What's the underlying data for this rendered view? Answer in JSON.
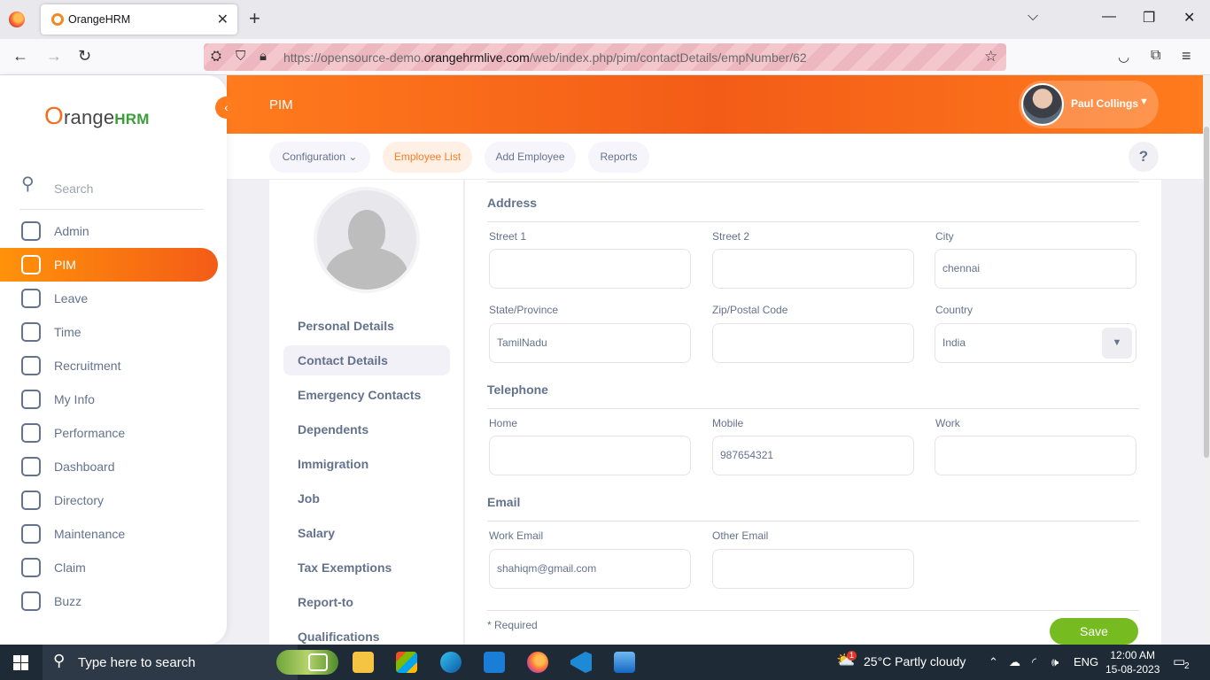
{
  "browser": {
    "tab_title": "OrangeHRM",
    "url_prefix": "https://opensource-demo.",
    "url_domain": "orangehrmlive.com",
    "url_path": "/web/index.php/pim/contactDetails/empNumber/62"
  },
  "sidebar": {
    "brand_o": "O",
    "brand_range": "range",
    "brand_hrm": "HRM",
    "search_placeholder": "Search",
    "items": [
      {
        "label": "Admin"
      },
      {
        "label": "PIM"
      },
      {
        "label": "Leave"
      },
      {
        "label": "Time"
      },
      {
        "label": "Recruitment"
      },
      {
        "label": "My Info"
      },
      {
        "label": "Performance"
      },
      {
        "label": "Dashboard"
      },
      {
        "label": "Directory"
      },
      {
        "label": "Maintenance"
      },
      {
        "label": "Claim"
      },
      {
        "label": "Buzz"
      }
    ]
  },
  "header": {
    "module": "PIM",
    "user_name": "Paul Collings"
  },
  "subnav": {
    "configuration": "Configuration",
    "employee_list": "Employee List",
    "add_employee": "Add Employee",
    "reports": "Reports",
    "help": "?"
  },
  "employee_tabs": [
    "Personal Details",
    "Contact Details",
    "Emergency Contacts",
    "Dependents",
    "Immigration",
    "Job",
    "Salary",
    "Tax Exemptions",
    "Report-to",
    "Qualifications"
  ],
  "form": {
    "address_title": "Address",
    "street1_label": "Street 1",
    "street1_value": "",
    "street2_label": "Street 2",
    "street2_value": "",
    "city_label": "City",
    "city_value": "chennai",
    "state_label": "State/Province",
    "state_value": "TamilNadu",
    "zip_label": "Zip/Postal Code",
    "zip_value": "",
    "country_label": "Country",
    "country_value": "India",
    "telephone_title": "Telephone",
    "home_label": "Home",
    "home_value": "",
    "mobile_label": "Mobile",
    "mobile_value": "987654321",
    "work_label": "Work",
    "work_value": "",
    "email_title": "Email",
    "work_email_label": "Work Email",
    "work_email_value": "shahiqm@gmail.com",
    "other_email_label": "Other Email",
    "other_email_value": "",
    "required_note": "* Required",
    "save_label": "Save"
  },
  "taskbar": {
    "search_text": "Type here to search",
    "weather_badge": "1",
    "weather": "25°C  Partly cloudy",
    "language": "ENG",
    "time": "12:00 AM",
    "date": "15-08-2023",
    "notification_count": "2"
  }
}
